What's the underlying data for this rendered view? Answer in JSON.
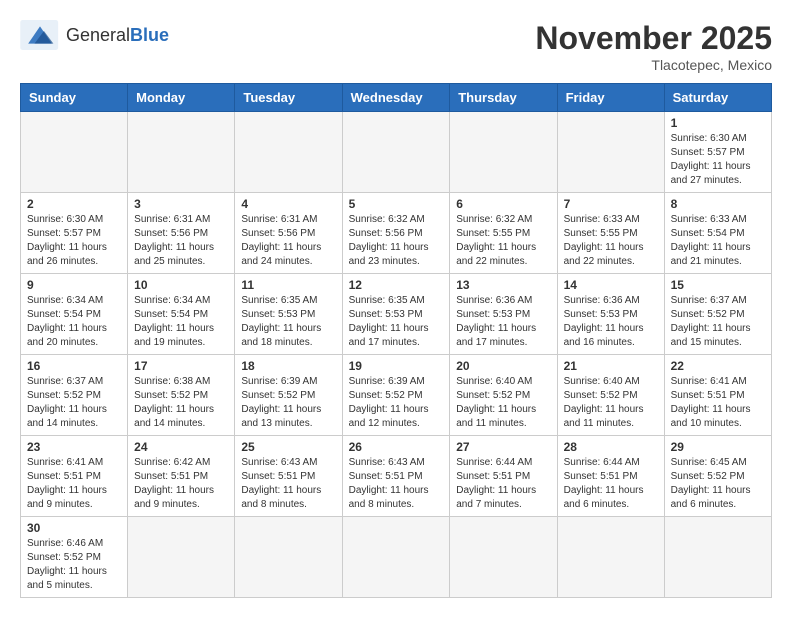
{
  "header": {
    "logo_general": "General",
    "logo_blue": "Blue",
    "month_title": "November 2025",
    "location": "Tlacotepec, Mexico"
  },
  "weekdays": [
    "Sunday",
    "Monday",
    "Tuesday",
    "Wednesday",
    "Thursday",
    "Friday",
    "Saturday"
  ],
  "weeks": [
    [
      {
        "day": "",
        "info": ""
      },
      {
        "day": "",
        "info": ""
      },
      {
        "day": "",
        "info": ""
      },
      {
        "day": "",
        "info": ""
      },
      {
        "day": "",
        "info": ""
      },
      {
        "day": "",
        "info": ""
      },
      {
        "day": "1",
        "info": "Sunrise: 6:30 AM\nSunset: 5:57 PM\nDaylight: 11 hours\nand 27 minutes."
      }
    ],
    [
      {
        "day": "2",
        "info": "Sunrise: 6:30 AM\nSunset: 5:57 PM\nDaylight: 11 hours\nand 26 minutes."
      },
      {
        "day": "3",
        "info": "Sunrise: 6:31 AM\nSunset: 5:56 PM\nDaylight: 11 hours\nand 25 minutes."
      },
      {
        "day": "4",
        "info": "Sunrise: 6:31 AM\nSunset: 5:56 PM\nDaylight: 11 hours\nand 24 minutes."
      },
      {
        "day": "5",
        "info": "Sunrise: 6:32 AM\nSunset: 5:56 PM\nDaylight: 11 hours\nand 23 minutes."
      },
      {
        "day": "6",
        "info": "Sunrise: 6:32 AM\nSunset: 5:55 PM\nDaylight: 11 hours\nand 22 minutes."
      },
      {
        "day": "7",
        "info": "Sunrise: 6:33 AM\nSunset: 5:55 PM\nDaylight: 11 hours\nand 22 minutes."
      },
      {
        "day": "8",
        "info": "Sunrise: 6:33 AM\nSunset: 5:54 PM\nDaylight: 11 hours\nand 21 minutes."
      }
    ],
    [
      {
        "day": "9",
        "info": "Sunrise: 6:34 AM\nSunset: 5:54 PM\nDaylight: 11 hours\nand 20 minutes."
      },
      {
        "day": "10",
        "info": "Sunrise: 6:34 AM\nSunset: 5:54 PM\nDaylight: 11 hours\nand 19 minutes."
      },
      {
        "day": "11",
        "info": "Sunrise: 6:35 AM\nSunset: 5:53 PM\nDaylight: 11 hours\nand 18 minutes."
      },
      {
        "day": "12",
        "info": "Sunrise: 6:35 AM\nSunset: 5:53 PM\nDaylight: 11 hours\nand 17 minutes."
      },
      {
        "day": "13",
        "info": "Sunrise: 6:36 AM\nSunset: 5:53 PM\nDaylight: 11 hours\nand 17 minutes."
      },
      {
        "day": "14",
        "info": "Sunrise: 6:36 AM\nSunset: 5:53 PM\nDaylight: 11 hours\nand 16 minutes."
      },
      {
        "day": "15",
        "info": "Sunrise: 6:37 AM\nSunset: 5:52 PM\nDaylight: 11 hours\nand 15 minutes."
      }
    ],
    [
      {
        "day": "16",
        "info": "Sunrise: 6:37 AM\nSunset: 5:52 PM\nDaylight: 11 hours\nand 14 minutes."
      },
      {
        "day": "17",
        "info": "Sunrise: 6:38 AM\nSunset: 5:52 PM\nDaylight: 11 hours\nand 14 minutes."
      },
      {
        "day": "18",
        "info": "Sunrise: 6:39 AM\nSunset: 5:52 PM\nDaylight: 11 hours\nand 13 minutes."
      },
      {
        "day": "19",
        "info": "Sunrise: 6:39 AM\nSunset: 5:52 PM\nDaylight: 11 hours\nand 12 minutes."
      },
      {
        "day": "20",
        "info": "Sunrise: 6:40 AM\nSunset: 5:52 PM\nDaylight: 11 hours\nand 11 minutes."
      },
      {
        "day": "21",
        "info": "Sunrise: 6:40 AM\nSunset: 5:52 PM\nDaylight: 11 hours\nand 11 minutes."
      },
      {
        "day": "22",
        "info": "Sunrise: 6:41 AM\nSunset: 5:51 PM\nDaylight: 11 hours\nand 10 minutes."
      }
    ],
    [
      {
        "day": "23",
        "info": "Sunrise: 6:41 AM\nSunset: 5:51 PM\nDaylight: 11 hours\nand 9 minutes."
      },
      {
        "day": "24",
        "info": "Sunrise: 6:42 AM\nSunset: 5:51 PM\nDaylight: 11 hours\nand 9 minutes."
      },
      {
        "day": "25",
        "info": "Sunrise: 6:43 AM\nSunset: 5:51 PM\nDaylight: 11 hours\nand 8 minutes."
      },
      {
        "day": "26",
        "info": "Sunrise: 6:43 AM\nSunset: 5:51 PM\nDaylight: 11 hours\nand 8 minutes."
      },
      {
        "day": "27",
        "info": "Sunrise: 6:44 AM\nSunset: 5:51 PM\nDaylight: 11 hours\nand 7 minutes."
      },
      {
        "day": "28",
        "info": "Sunrise: 6:44 AM\nSunset: 5:51 PM\nDaylight: 11 hours\nand 6 minutes."
      },
      {
        "day": "29",
        "info": "Sunrise: 6:45 AM\nSunset: 5:52 PM\nDaylight: 11 hours\nand 6 minutes."
      }
    ],
    [
      {
        "day": "30",
        "info": "Sunrise: 6:46 AM\nSunset: 5:52 PM\nDaylight: 11 hours\nand 5 minutes."
      },
      {
        "day": "",
        "info": ""
      },
      {
        "day": "",
        "info": ""
      },
      {
        "day": "",
        "info": ""
      },
      {
        "day": "",
        "info": ""
      },
      {
        "day": "",
        "info": ""
      },
      {
        "day": "",
        "info": ""
      }
    ]
  ]
}
